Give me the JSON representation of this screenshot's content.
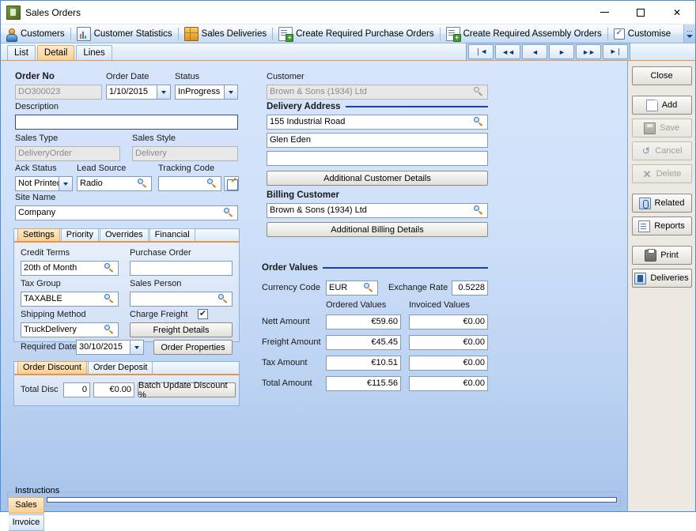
{
  "window": {
    "title": "Sales Orders",
    "minimize_label": "Minimize",
    "maximize_label": "Maximize",
    "close_label": "Close"
  },
  "toolbar": {
    "items": [
      {
        "label": "Customers",
        "icon": "person-icon"
      },
      {
        "label": "Customer Statistics",
        "icon": "bar-chart-icon"
      },
      {
        "label": "Sales Deliveries",
        "icon": "box-icon"
      },
      {
        "label": "Create Required Purchase Orders",
        "icon": "document-add-icon"
      },
      {
        "label": "Create Required Assembly Orders",
        "icon": "document-add-icon"
      },
      {
        "label": "Customise",
        "icon": "checkbox-icon"
      }
    ]
  },
  "tabs": {
    "items": [
      {
        "label": "List",
        "active": false
      },
      {
        "label": "Detail",
        "active": true
      },
      {
        "label": "Lines",
        "active": false
      }
    ]
  },
  "nav": {
    "first": "❘◄",
    "prev_page": "◄◄",
    "prev": "◄",
    "next": "►",
    "next_page": "►►",
    "last": "►❘"
  },
  "order": {
    "order_no_label": "Order No",
    "order_no_value": "DO300023",
    "order_date_label": "Order Date",
    "order_date_value": "1/10/2015",
    "status_label": "Status",
    "status_value": "InProgress",
    "description_label": "Description",
    "description_value": "",
    "sales_type_label": "Sales Type",
    "sales_type_value": "DeliveryOrder",
    "sales_style_label": "Sales Style",
    "sales_style_value": "Delivery",
    "ack_status_label": "Ack Status",
    "ack_status_value": "Not Printed",
    "lead_source_label": "Lead Source",
    "lead_source_value": "Radio",
    "tracking_code_label": "Tracking Code",
    "tracking_code_value": "",
    "site_name_label": "Site Name",
    "site_name_value": "Company"
  },
  "settings_panel": {
    "tabs": [
      {
        "label": "Settings",
        "active": true
      },
      {
        "label": "Priority",
        "active": false
      },
      {
        "label": "Overrides",
        "active": false
      },
      {
        "label": "Financial",
        "active": false
      }
    ],
    "credit_terms_label": "Credit Terms",
    "credit_terms_value": "20th of Month",
    "purchase_order_label": "Purchase Order",
    "purchase_order_value": "",
    "tax_group_label": "Tax Group",
    "tax_group_value": "TAXABLE",
    "sales_person_label": "Sales Person",
    "sales_person_value": "",
    "shipping_method_label": "Shipping Method",
    "shipping_method_value": "TruckDelivery",
    "charge_freight_label": "Charge Freight",
    "charge_freight_checked": "✔",
    "freight_details_label": "Freight Details",
    "required_date_label": "Required Date",
    "required_date_value": "30/10/2015",
    "order_properties_label": "Order Properties"
  },
  "discount_panel": {
    "tabs": [
      {
        "label": "Order Discount",
        "active": true
      },
      {
        "label": "Order Deposit",
        "active": false
      }
    ],
    "total_disc_label": "Total Disc",
    "total_disc_pct": "0",
    "total_disc_amount": "€0.00",
    "batch_update_label": "Batch Update Discount %"
  },
  "customer": {
    "customer_label": "Customer",
    "customer_value": "Brown & Sons (1934) Ltd",
    "delivery_address_label": "Delivery Address",
    "address_line1": "155 Industrial Road",
    "address_line2": "Glen Eden",
    "address_line3": "",
    "additional_customer_details_label": "Additional Customer Details",
    "billing_customer_label": "Billing Customer",
    "billing_customer_value": "Brown & Sons (1934) Ltd",
    "additional_billing_details_label": "Additional Billing Details"
  },
  "order_values": {
    "heading": "Order Values",
    "currency_code_label": "Currency Code",
    "currency_code_value": "EUR",
    "exchange_rate_label": "Exchange Rate",
    "exchange_rate_value": "0.5228",
    "col_ordered": "Ordered Values",
    "col_invoiced": "Invoiced Values",
    "rows": [
      {
        "label": "Nett Amount",
        "ordered": "€59.60",
        "invoiced": "€0.00"
      },
      {
        "label": "Freight Amount",
        "ordered": "€45.45",
        "invoiced": "€0.00"
      },
      {
        "label": "Tax Amount",
        "ordered": "€10.51",
        "invoiced": "€0.00"
      },
      {
        "label": "Total Amount",
        "ordered": "€115.56",
        "invoiced": "€0.00"
      }
    ]
  },
  "instructions": {
    "group_label": "Instructions",
    "tabs": [
      {
        "label": "Sales",
        "active": true
      },
      {
        "label": "Invoice",
        "active": false
      }
    ],
    "text": ""
  },
  "side_buttons": [
    {
      "label": "Close",
      "icon": "",
      "disabled": false
    },
    {
      "label": "Add",
      "icon": "page-icon",
      "disabled": false
    },
    {
      "label": "Save",
      "icon": "floppy-icon",
      "disabled": true
    },
    {
      "label": "Cancel",
      "icon": "undo-icon",
      "disabled": true
    },
    {
      "label": "Delete",
      "icon": "x-icon",
      "disabled": true
    },
    {
      "label": "Related",
      "icon": "link-icon",
      "disabled": false
    },
    {
      "label": "Reports",
      "icon": "report-icon",
      "disabled": false
    },
    {
      "label": "Print",
      "icon": "printer-icon",
      "disabled": false
    },
    {
      "label": "Deliveries",
      "icon": "delivery-icon",
      "disabled": false
    }
  ],
  "colors": {
    "accent_blue": "#1d3fa0",
    "tab_active": "#f9cf92",
    "tab_underline": "#e8954b",
    "window_border": "#4a90d9",
    "form_bg_top": "#d7e5fb",
    "form_bg_bottom": "#a7c3ea"
  }
}
